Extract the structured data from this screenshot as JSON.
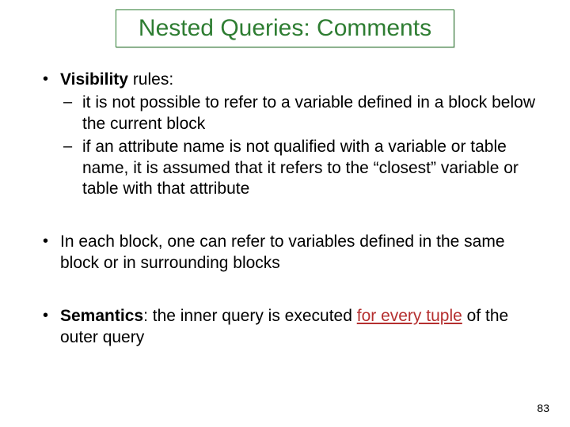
{
  "title": "Nested Queries: Comments",
  "bullets": {
    "b1": {
      "strong": "Visibility",
      "rest": " rules:",
      "sub1": "it is not possible to refer to a variable defined in a block below the current block",
      "sub2": "if an attribute name is not qualified with a variable or table name, it is assumed that it refers to the “closest” variable or table with that attribute"
    },
    "b2": "In each block, one can refer to variables defined in the same block or in surrounding blocks",
    "b3": {
      "strong": "Semantics",
      "mid1": ": the inner query is executed ",
      "red": "for every tuple",
      "mid2": " of the outer query"
    }
  },
  "page_number": "83"
}
